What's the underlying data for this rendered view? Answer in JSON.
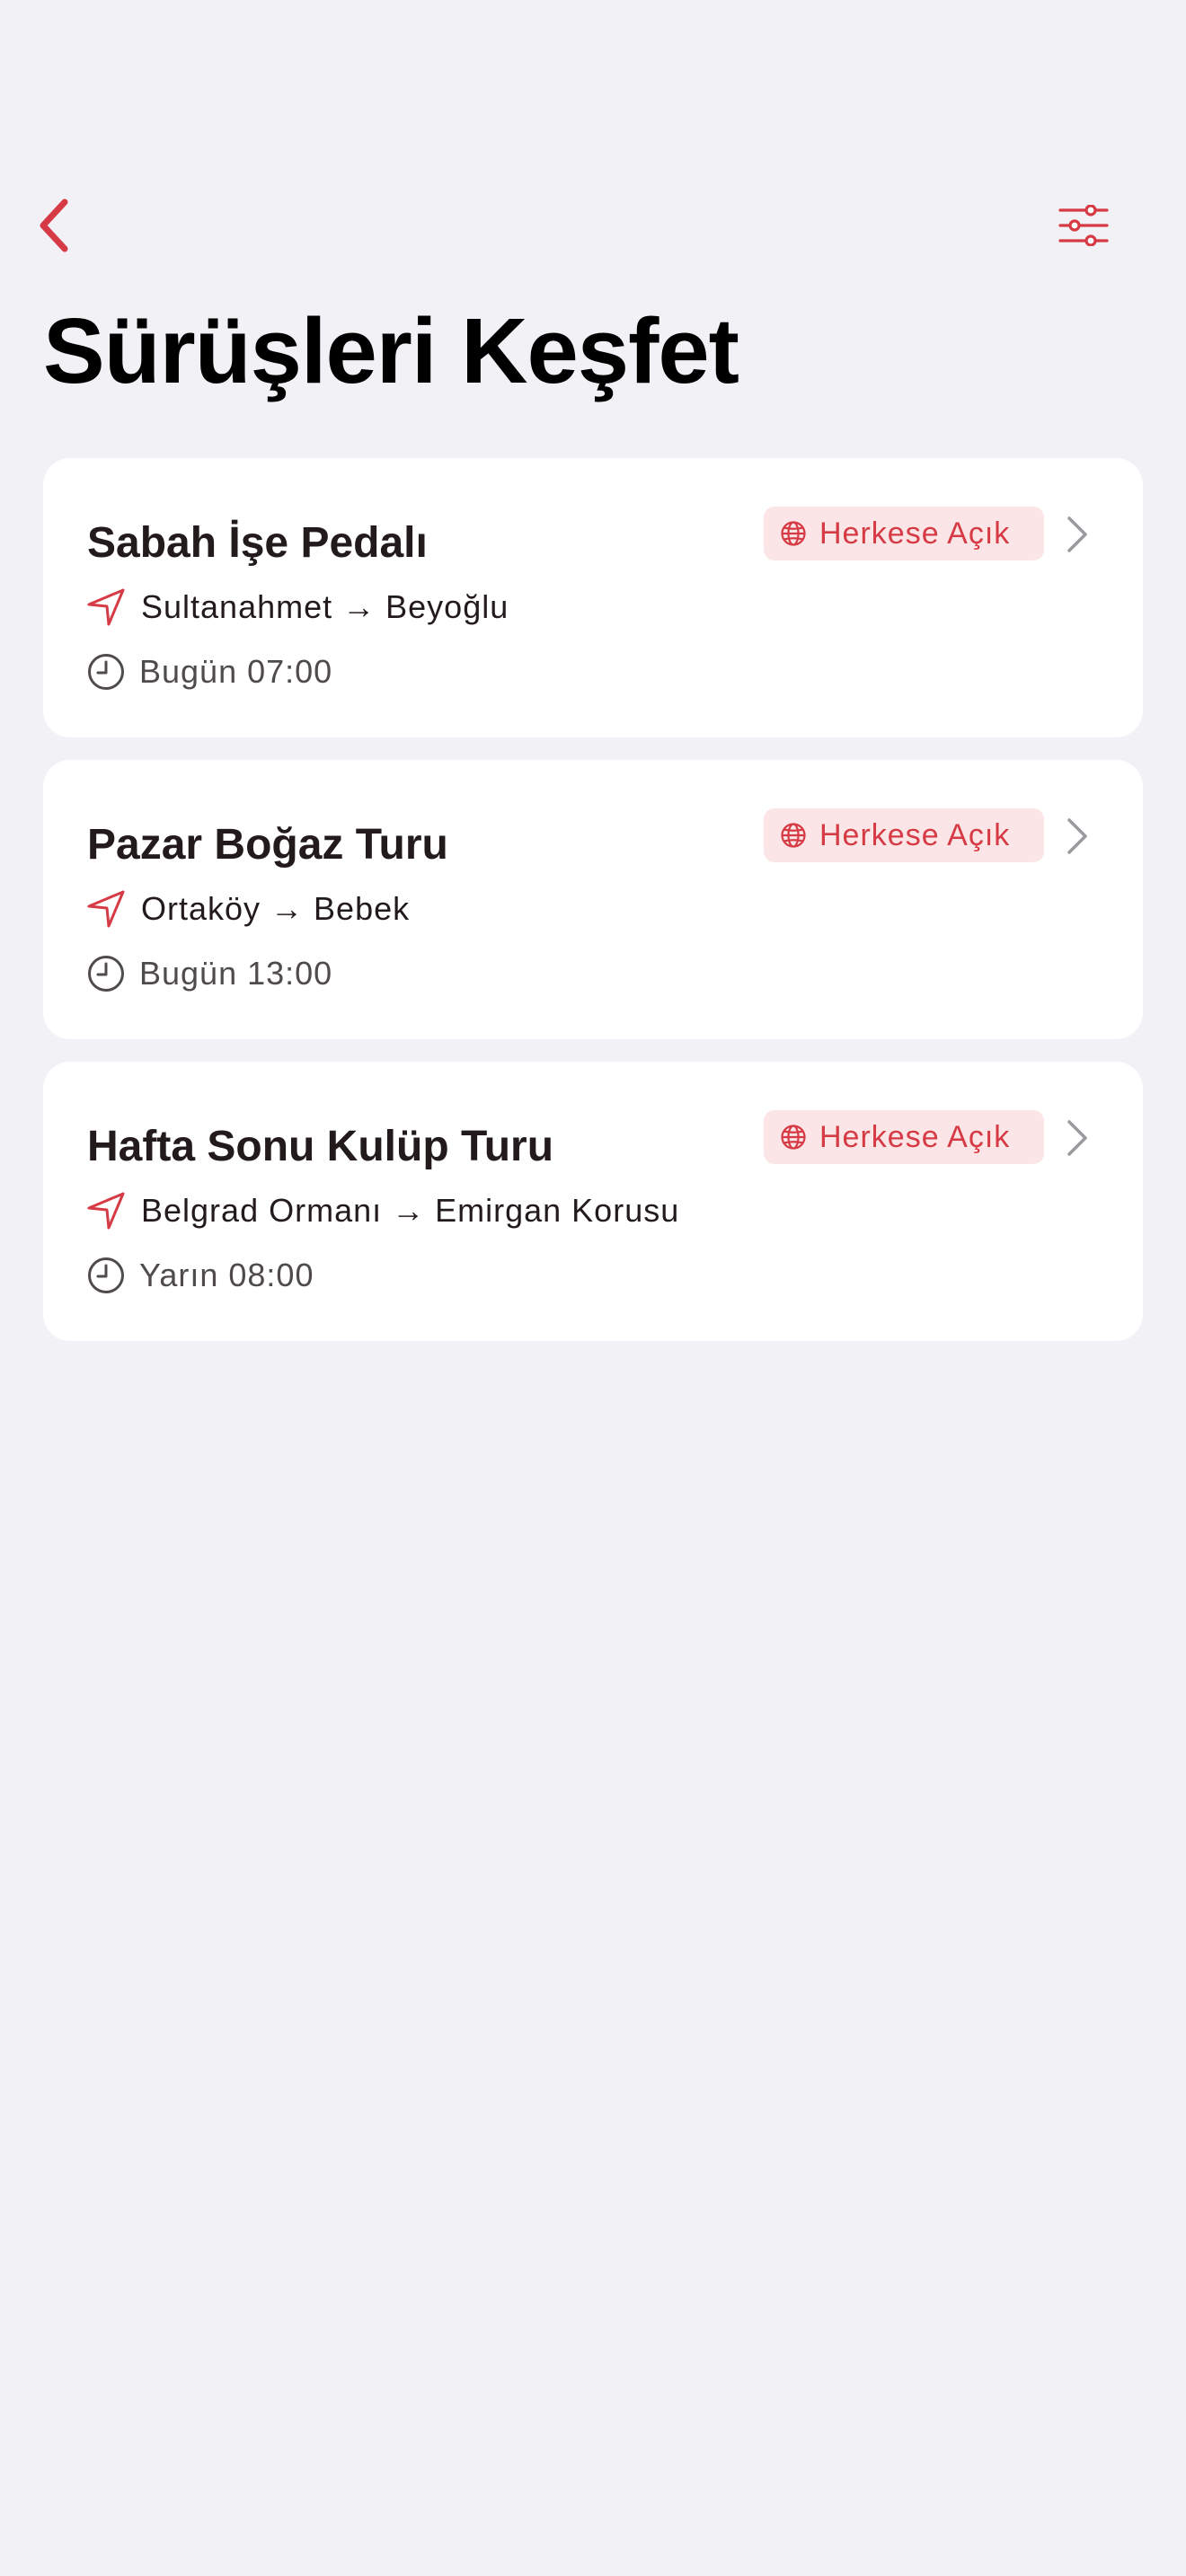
{
  "nav": {
    "back_icon": "chevron-left-icon",
    "filter_icon": "sliders-icon"
  },
  "header": {
    "title": "Sürüşleri Keşfet"
  },
  "rides": [
    {
      "name": "Sabah İşe Pedalı",
      "visibility": "Herkese Açık",
      "route": "Sultanahmet → Beyoğlu",
      "time": "Bugün 07:00"
    },
    {
      "name": "Pazar Boğaz Turu",
      "visibility": "Herkese Açık",
      "route": "Ortaköy → Bebek",
      "time": "Bugün 13:00"
    },
    {
      "name": "Hafta Sonu Kulüp Turu",
      "visibility": "Herkese Açık",
      "route": "Belgrad Ormanı → Emirgan Korusu",
      "time": "Yarın 08:00"
    }
  ],
  "icons": {
    "visibility": "globe-icon",
    "route": "location-arrow-icon",
    "time": "clock-icon",
    "disclosure": "chevron-right-icon"
  },
  "colors": {
    "accent": "#d63a44",
    "badge_bg": "#fbe5e6",
    "background": "#f2f1f6",
    "card": "#ffffff"
  }
}
